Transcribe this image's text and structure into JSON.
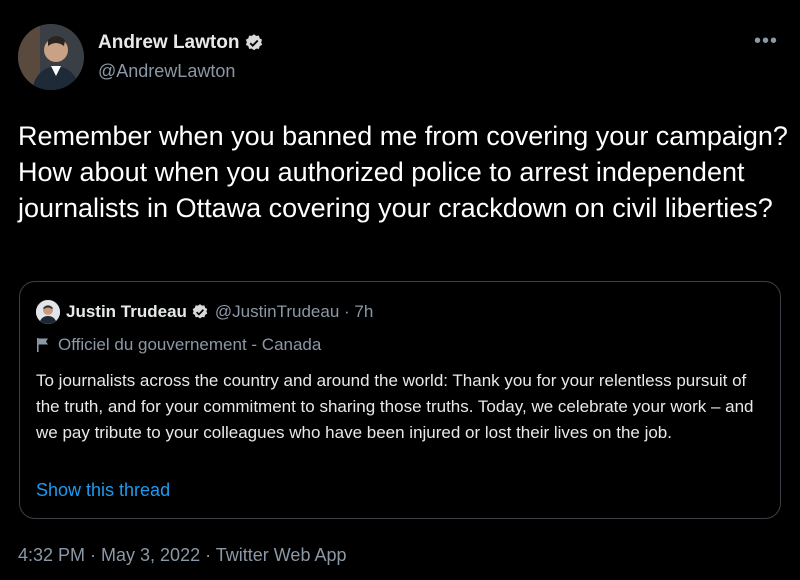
{
  "author": {
    "display_name": "Andrew Lawton",
    "handle": "@AndrewLawton"
  },
  "icons": {
    "more": "more-options-icon",
    "verified": "verified-badge-icon",
    "flag": "flag-icon"
  },
  "colors": {
    "background": "#000000",
    "text": "#e7e9ea",
    "secondary": "#8b98a5",
    "link": "#1d9bf0",
    "verified": "#d9d9d9",
    "border": "#3b4046"
  },
  "tweet": {
    "text": "Remember when you banned me from covering your campaign? How about when you authorized police to arrest independent journalists in Ottawa covering your crackdown on civil liberties?"
  },
  "quoted": {
    "display_name": "Justin Trudeau",
    "handle_time": "@JustinTrudeau · 7h",
    "label": "Officiel du gouvernement - Canada",
    "text": "To journalists across the country and around the world: Thank you for your relentless pursuit of the truth, and for your commitment to sharing those truths. Today, we celebrate your work – and we pay tribute to your colleagues who have been injured or lost their lives on the job.",
    "show_thread": "Show this thread"
  },
  "meta": {
    "timestamp": "4:32 PM · May 3, 2022 · Twitter Web App"
  }
}
